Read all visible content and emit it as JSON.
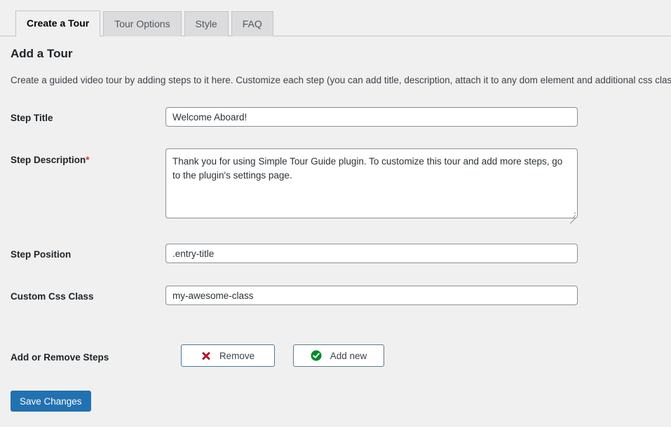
{
  "tabs": [
    {
      "label": "Create a Tour",
      "active": true
    },
    {
      "label": "Tour Options",
      "active": false
    },
    {
      "label": "Style",
      "active": false
    },
    {
      "label": "FAQ",
      "active": false
    }
  ],
  "page": {
    "title": "Add a Tour",
    "description": "Create a guided video tour by adding steps to it here. Customize each step (you can add title, description, attach it to any dom element and additional css class)"
  },
  "fields": {
    "step_title": {
      "label": "Step Title",
      "value": "Welcome Aboard!",
      "placeholder": ""
    },
    "step_description": {
      "label": "Step Description",
      "required_marker": "*",
      "value": "Thank you for using Simple Tour Guide plugin. To customize this tour and add more steps, go to the plugin's settings page.",
      "placeholder": ""
    },
    "step_position": {
      "label": "Step Position",
      "value": ".entry-title",
      "placeholder": ""
    },
    "custom_css_class": {
      "label": "Custom Css Class",
      "value": "my-awesome-class",
      "placeholder": ""
    }
  },
  "steps_controls": {
    "label": "Add or Remove Steps",
    "remove_button": {
      "label": "Remove",
      "icon": "red-x-icon"
    },
    "add_button": {
      "label": "Add new",
      "icon": "green-check-circle-icon"
    }
  },
  "submit": {
    "save_label": "Save Changes"
  },
  "colors": {
    "primary": "#2271b1",
    "danger": "#b01b2e",
    "success": "#00a32a",
    "background": "#f0f0f1",
    "border": "#8c8f94"
  }
}
